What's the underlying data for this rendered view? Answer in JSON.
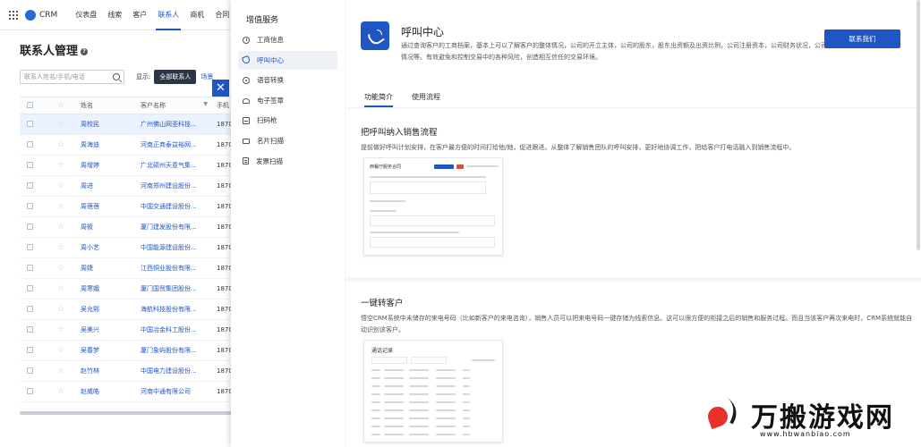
{
  "topnav": {
    "logo": "CRM",
    "items": [
      "仪表盘",
      "线索",
      "客户",
      "联系人",
      "商机",
      "合同"
    ],
    "active_index": 3
  },
  "page": {
    "title": "联系人管理",
    "search_placeholder": "联系人姓名/手机/电话",
    "filter_label": "显示:",
    "filter_value": "全部联系人",
    "filter_more": "场景"
  },
  "table": {
    "headers": {
      "name": "姓名",
      "customer": "客户名称",
      "phone": "手机"
    },
    "rows": [
      {
        "name": "周校民",
        "customer": "广州佛山网圣科技...",
        "phone": "18703"
      },
      {
        "name": "周海迪",
        "customer": "河南正商泰益裕网...",
        "phone": "18703"
      },
      {
        "name": "周增婷",
        "customer": "广北硕州天意气集...",
        "phone": "18703"
      },
      {
        "name": "周进",
        "customer": "河南郑州建设股份...",
        "phone": "18703"
      },
      {
        "name": "周蓓蓓",
        "customer": "中国交通建设股份...",
        "phone": "18703"
      },
      {
        "name": "周筱",
        "customer": "厦门建发股份有限...",
        "phone": "18703"
      },
      {
        "name": "周小艺",
        "customer": "中国能源建设股份...",
        "phone": "18703"
      },
      {
        "name": "周婕",
        "customer": "江西铜业股份有限...",
        "phone": "18703"
      },
      {
        "name": "周寒娥",
        "customer": "厦门国贸集团股份...",
        "phone": "18703"
      },
      {
        "name": "吴允熙",
        "customer": "海航科技股份有限...",
        "phone": "18703"
      },
      {
        "name": "吴美兴",
        "customer": "中国冶金科工股份...",
        "phone": "18703"
      },
      {
        "name": "吴春梦",
        "customer": "厦门象屿股份有限...",
        "phone": "18703"
      },
      {
        "name": "赵竹林",
        "customer": "中国电力建设股份...",
        "phone": "18703"
      },
      {
        "name": "赵威皓",
        "customer": "河南中通有限公司",
        "phone": "18703"
      }
    ],
    "selected_index": 0
  },
  "drawer": {
    "sidebar_title": "增值服务",
    "items": [
      {
        "label": "工商信息",
        "icon": "info-icon"
      },
      {
        "label": "呼叫中心",
        "icon": "phone-icon"
      },
      {
        "label": "语音转换",
        "icon": "voice-icon"
      },
      {
        "label": "电子签章",
        "icon": "seal-icon"
      },
      {
        "label": "扫码枪",
        "icon": "scanner-icon"
      },
      {
        "label": "名片扫描",
        "icon": "card-icon"
      },
      {
        "label": "发票扫描",
        "icon": "invoice-icon"
      }
    ],
    "active_index": 1,
    "service": {
      "title": "呼叫中心",
      "description": "通过查询客户的工商档案，基本上可以了解客户的整体情况，公司的开立主体，公司的股东，股东出资额及出资比例，公司注册资本，公司财务状况，公司年检情况等。有效避免和控制交易中的各种风险，创造相互信任的交易环境。",
      "contact_button": "联系我们",
      "tabs": [
        "功能简介",
        "使用流程"
      ],
      "active_tab": 0
    },
    "sections": [
      {
        "title": "把呼叫纳入销售流程",
        "description": "提前做好呼叫计划安排，在客户最方便的时间打给他/她，促进跟进。从整体了解销售团队的呼叫安排，更好地协调工作，把给客户打电话融入到销售流程中。",
        "mock_title": "西餐厅服务合同"
      },
      {
        "title": "一键转客户",
        "description": "悟空CRM系统中未储存的来电号码（比如新客户的来电咨询），销售人员可以把来电号码一键存储为线索信息。这可以很方便的衔接之后的销售和服务过程。而且当该客户再次来电时，CRM系统就能自动识别该客户。",
        "mock_title": "通话记录"
      }
    ]
  },
  "watermark": {
    "text": "万搬游戏网",
    "url": "www.hbwanbiao.com"
  },
  "colors": {
    "primary": "#1f56c3",
    "dark_button": "#2b3545",
    "danger": "#e04a3a"
  }
}
